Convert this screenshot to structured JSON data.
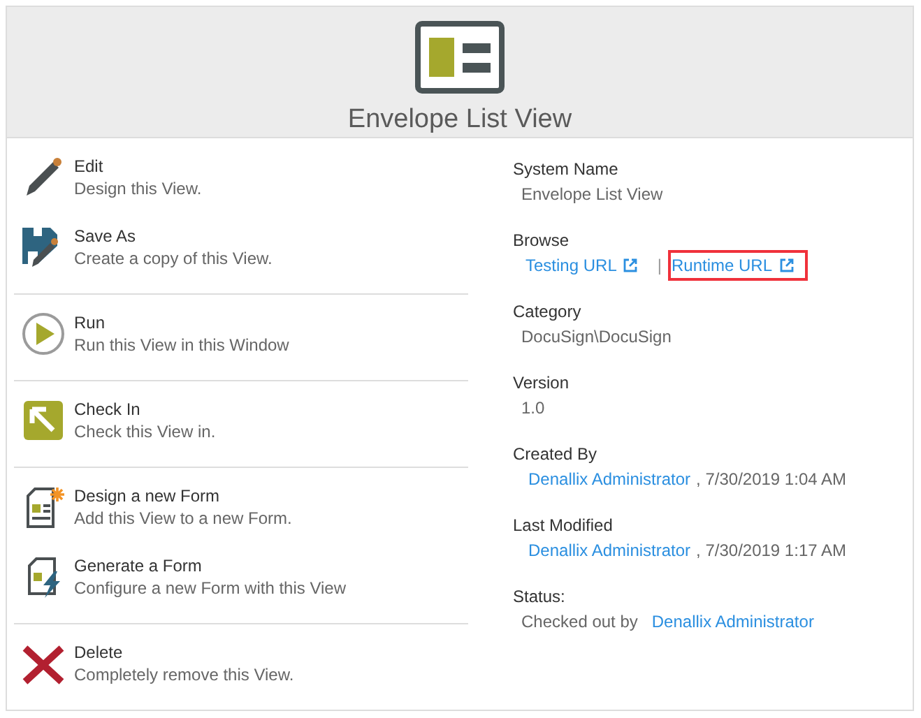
{
  "header": {
    "title": "Envelope List View"
  },
  "action_groups": [
    [
      {
        "kind": "edit",
        "title": "Edit",
        "description": "Design this View."
      },
      {
        "kind": "save-as",
        "title": "Save As",
        "description": "Create a copy of this View."
      }
    ],
    [
      {
        "kind": "run",
        "title": "Run",
        "description": "Run this View in this Window"
      }
    ],
    [
      {
        "kind": "check-in",
        "title": "Check In",
        "description": "Check this View in."
      }
    ],
    [
      {
        "kind": "new-form",
        "title": "Design a new Form",
        "description": "Add this View to a new Form."
      },
      {
        "kind": "generate-form",
        "title": "Generate a Form",
        "description": "Configure a new Form with this View"
      }
    ],
    [
      {
        "kind": "delete",
        "title": "Delete",
        "description": "Completely remove this View."
      }
    ]
  ],
  "details": [
    {
      "kind": "text",
      "label": "System Name",
      "value": "Envelope List View"
    },
    {
      "kind": "links",
      "label": "Browse",
      "separator": "|",
      "links": [
        {
          "text": "Testing URL",
          "highlighted": false
        },
        {
          "text": "Runtime URL",
          "highlighted": true
        }
      ]
    },
    {
      "kind": "text",
      "label": "Category",
      "value": "DocuSign\\DocuSign"
    },
    {
      "kind": "text",
      "label": "Version",
      "value": "1.0"
    },
    {
      "kind": "user",
      "label": "Created By",
      "user": "Denallix Administrator",
      "suffix": ", 7/30/2019 1:04 AM"
    },
    {
      "kind": "user",
      "label": "Last Modified",
      "user": "Denallix Administrator",
      "suffix": ", 7/30/2019 1:17 AM"
    },
    {
      "kind": "status",
      "label": "Status:",
      "prefix": "Checked out by",
      "user": "Denallix Administrator"
    }
  ]
}
